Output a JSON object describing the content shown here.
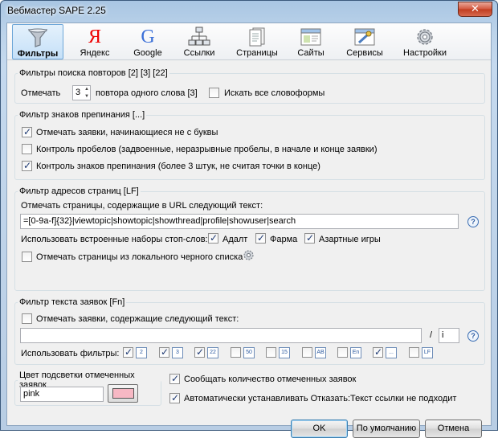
{
  "window": {
    "title": "Вебмастер SAPE 2.25",
    "close": "✕"
  },
  "toolbar": {
    "items": [
      {
        "label": "Фильтры",
        "active": true
      },
      {
        "label": "Яндекс"
      },
      {
        "label": "Google"
      },
      {
        "label": "Ссылки"
      },
      {
        "label": "Страницы"
      },
      {
        "label": "Сайты"
      },
      {
        "label": "Сервисы"
      },
      {
        "label": "Настройки"
      }
    ],
    "yandex_glyph": "Я",
    "google_glyph": "G"
  },
  "repeat_filter": {
    "legend": "Фильтры поиска повторов [2] [3] [22]",
    "mark_label": "Отмечать",
    "count": "3",
    "count_suffix": "повтора одного слова [3]",
    "all_forms_label": "Искать все словоформы",
    "all_forms_checked": false
  },
  "punct_filter": {
    "legend": "Фильтр знаков препинания [...]",
    "items": [
      {
        "label": "Отмечать заявки, начинающиеся не с буквы",
        "checked": true
      },
      {
        "label": "Контроль пробелов (задвоенные, неразрывные пробелы, в начале и конце заявки)",
        "checked": false
      },
      {
        "label": "Контроль знаков препинания (более 3 штук, не считая точки в конце)",
        "checked": true
      }
    ]
  },
  "url_filter": {
    "legend": "Фильтр адресов страниц [LF]",
    "caption": "Отмечать страницы, содержащие в URL следующий текст:",
    "pattern": "=[0-9a-f]{32}|viewtopic|showtopic|showthread|profile|showuser|search",
    "stop_label": "Использовать встроенные наборы стоп-слов:",
    "stop_sets": [
      {
        "label": "Адалт",
        "checked": true
      },
      {
        "label": "Фарма",
        "checked": true
      },
      {
        "label": "Азартные игры",
        "checked": true
      }
    ],
    "blacklist_label": "Отмечать страницы из локального черного списка",
    "blacklist_checked": false,
    "help": "?"
  },
  "text_filter": {
    "legend": "Фильтр текста заявок [Fn]",
    "mark_label": "Отмечать заявки, содержащие следующий текст:",
    "mark_checked": false,
    "text_value": "",
    "separator": "/",
    "flags_value": "i",
    "use_label": "Использовать фильтры:",
    "filters": [
      {
        "tag": "2",
        "checked": true
      },
      {
        "tag": "3",
        "checked": true
      },
      {
        "tag": "22",
        "checked": true
      },
      {
        "tag": "50",
        "checked": false
      },
      {
        "tag": "15",
        "checked": false
      },
      {
        "tag": "AB",
        "checked": false
      },
      {
        "tag": "En",
        "checked": false
      },
      {
        "tag": "...",
        "checked": true
      },
      {
        "tag": "LF",
        "checked": false
      }
    ],
    "help": "?"
  },
  "highlight": {
    "legend": "Цвет подсветки отмеченных заявок",
    "value": "pink",
    "swatch_color": "#f7b8c4"
  },
  "options": [
    {
      "label": "Сообщать количество отмеченных заявок",
      "checked": true
    },
    {
      "label": "Автоматически устанавливать Отказать:Текст ссылки не подходит",
      "checked": true
    }
  ],
  "buttons": {
    "ok": "OK",
    "defaults": "По умолчанию",
    "cancel": "Отмена"
  }
}
